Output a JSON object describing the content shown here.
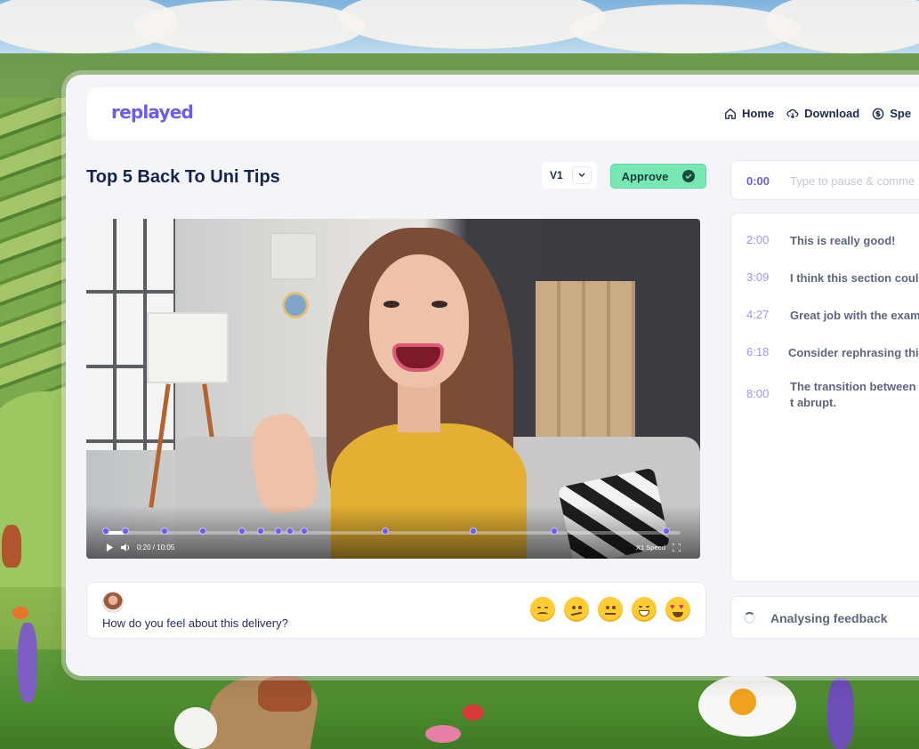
{
  "app": {
    "logo": "replayed"
  },
  "nav": {
    "items": [
      {
        "label": "Home",
        "icon": "home-icon"
      },
      {
        "label": "Download",
        "icon": "download-cloud-icon"
      },
      {
        "label": "Spe",
        "icon": "dollar-circle-icon"
      }
    ]
  },
  "video_title": "Top 5 Back To Uni Tips",
  "version": {
    "selected": "V1"
  },
  "approve_label": "Approve",
  "player": {
    "current_time": "0:20",
    "duration": "10:05",
    "time_display": "0:20 / 10:05",
    "speed_label": "X1 Speed",
    "progress": 0.033,
    "comment_markers": [
      0.0,
      0.034,
      0.102,
      0.169,
      0.237,
      0.27,
      0.3,
      0.32,
      0.345,
      0.486,
      0.64,
      0.78,
      0.975
    ]
  },
  "feedback_prompt": {
    "question": "How do you feel about this delivery?",
    "emojis": [
      "very-dissatisfied-icon",
      "confused-icon",
      "neutral-icon",
      "grinning-icon",
      "heart-eyes-icon"
    ]
  },
  "comment_input": {
    "timestamp": "0:00",
    "placeholder": "Type to pause & comme"
  },
  "comments": [
    {
      "time": "2:00",
      "text": "This is really good!"
    },
    {
      "time": "3:09",
      "text": "I think this section coul"
    },
    {
      "time": "4:27",
      "text": "Great job with the exam"
    },
    {
      "time": "6:18",
      "text": "Consider rephrasing thi"
    },
    {
      "time": "8:00",
      "text": "The transition between t abrupt."
    }
  ],
  "status": {
    "label": "Analysing feedback"
  },
  "colors": {
    "accent": "#6b5bf2",
    "approve": "#77e8b3",
    "title": "#14244a"
  }
}
